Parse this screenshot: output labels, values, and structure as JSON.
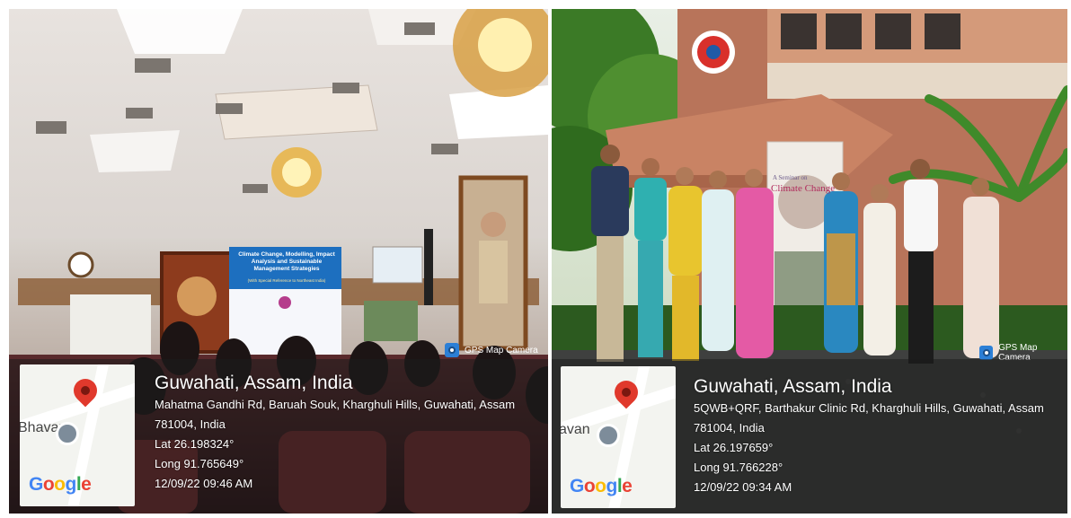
{
  "left_photo": {
    "slide": {
      "title": "Climate Change, Modelling, Impact Analysis and Sustainable Management Strategies",
      "subtitle": "(With Special Reference to Northeast India)"
    },
    "watermark": {
      "camera_label": "GPS Map Camera",
      "map_place": "Bhavan",
      "map_logo": "Google",
      "location_title": "Guwahati, Assam, India",
      "address_line1": "Mahatma Gandhi Rd, Baruah Souk, Kharghuli Hills, Guwahati, Assam",
      "address_line2": "781004, India",
      "lat": "Lat 26.198324°",
      "long": "Long 91.765649°",
      "datetime": "12/09/22 09:46 AM"
    }
  },
  "right_photo": {
    "banner": {
      "line1": "A Seminar on",
      "line2": "Climate Change"
    },
    "watermark": {
      "camera_label": "GPS Map Camera",
      "map_place": "avan",
      "map_logo": "Google",
      "location_title": "Guwahati, Assam, India",
      "address_line1": "5QWB+QRF, Barthakur Clinic Rd, Kharghuli Hills, Guwahati, Assam",
      "address_line2": "781004, India",
      "lat": "Lat 26.197659°",
      "long": "Long 91.766228°",
      "datetime": "12/09/22 09:34 AM"
    }
  },
  "colors": {
    "slide_bg": "#1d6fbf",
    "map_pin": "#e0392c",
    "watermark_text": "#ffffff"
  },
  "icons": [
    "camera-icon",
    "map-pin-icon",
    "google-logo"
  ]
}
